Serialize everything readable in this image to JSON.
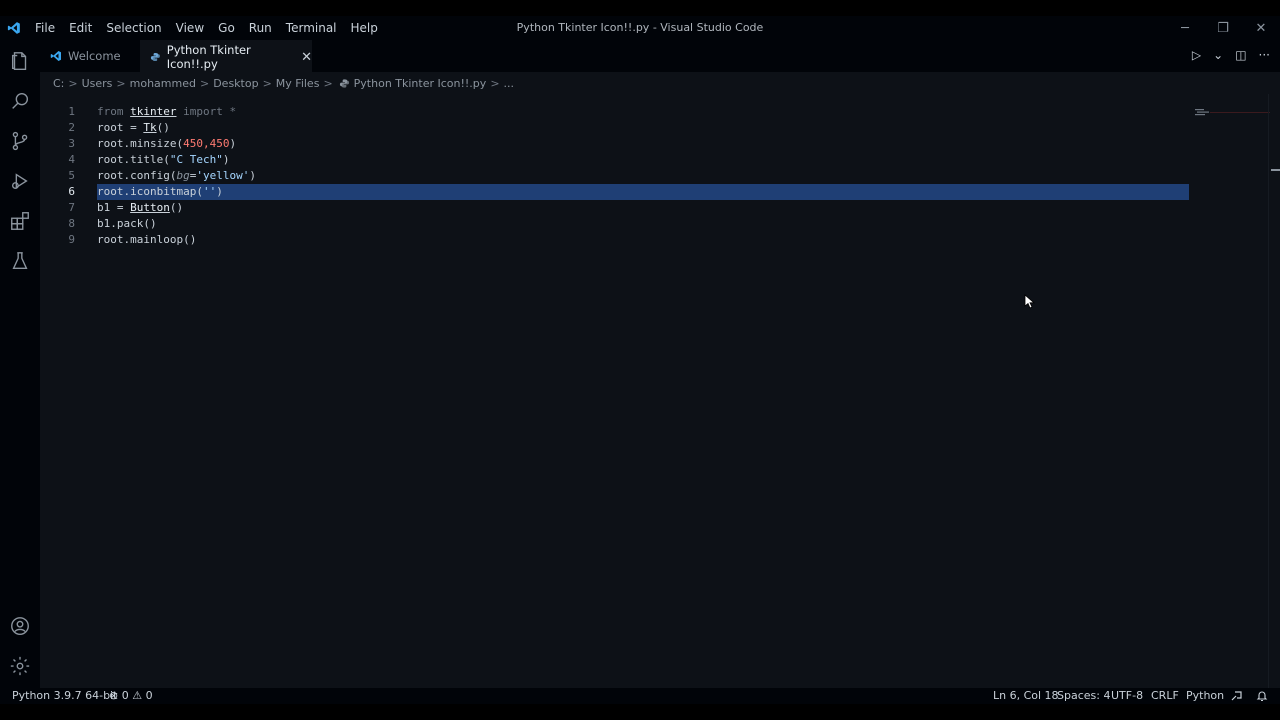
{
  "window": {
    "title": "Python Tkinter Icon!!.py - Visual Studio Code",
    "controls": {
      "minimize": "─",
      "restore": "❐",
      "close": "✕"
    }
  },
  "menu": [
    "File",
    "Edit",
    "Selection",
    "View",
    "Go",
    "Run",
    "Terminal",
    "Help"
  ],
  "tabs": [
    {
      "label": "Welcome",
      "active": false
    },
    {
      "label": "Python Tkinter Icon!!.py",
      "active": true,
      "close": "✕"
    }
  ],
  "tab_actions": {
    "run": "▷",
    "run_menu": "⌄",
    "split": "◫",
    "more": "···"
  },
  "breadcrumb": [
    "C:",
    "Users",
    "mohammed",
    "Desktop",
    "My Files",
    "Python Tkinter Icon!!.py",
    "..."
  ],
  "breadcrumb_sep": ">",
  "editor": {
    "lines": [
      {
        "n": "1",
        "t": [
          [
            "kw",
            "from "
          ],
          [
            "mod",
            "tkinter"
          ],
          [
            "kw",
            " import *"
          ]
        ]
      },
      {
        "n": "2",
        "t": [
          [
            "fn",
            "root = "
          ],
          [
            "mod",
            "Tk"
          ],
          [
            "fn",
            "()"
          ]
        ]
      },
      {
        "n": "3",
        "t": [
          [
            "fn",
            "root.minsize("
          ],
          [
            "num",
            "450,450"
          ],
          [
            "fn",
            ")"
          ]
        ]
      },
      {
        "n": "4",
        "t": [
          [
            "fn",
            "root.title("
          ],
          [
            "str",
            "\"C Tech\""
          ],
          [
            "fn",
            ")"
          ]
        ]
      },
      {
        "n": "5",
        "t": [
          [
            "fn",
            "root.config("
          ],
          [
            "prm",
            "bg"
          ],
          [
            "fn",
            "="
          ],
          [
            "str",
            "'yellow'"
          ],
          [
            "fn",
            ")"
          ]
        ]
      },
      {
        "n": "6",
        "t": [
          [
            "fn",
            "root.iconbitmap("
          ],
          [
            "str",
            "''"
          ],
          [
            "fn",
            ")"
          ]
        ],
        "current": true
      },
      {
        "n": "7",
        "t": [
          [
            "fn",
            "b1 = "
          ],
          [
            "mod",
            "Button"
          ],
          [
            "fn",
            "()"
          ]
        ]
      },
      {
        "n": "8",
        "t": [
          [
            "fn",
            "b1.pack()"
          ]
        ]
      },
      {
        "n": "9",
        "t": [
          [
            "fn",
            "root.mainloop()"
          ]
        ]
      }
    ]
  },
  "status": {
    "interpreter": "Python 3.9.7 64-bit",
    "errors": "0",
    "warnings": "0",
    "position": "Ln 6, Col 18",
    "spaces": "Spaces: 4",
    "encoding": "UTF-8",
    "eol": "CRLF",
    "language": "Python"
  },
  "colors": {
    "background": "#0d1117",
    "chrome": "#010409",
    "selection": "#1f3f75",
    "accent": "#007acc"
  }
}
